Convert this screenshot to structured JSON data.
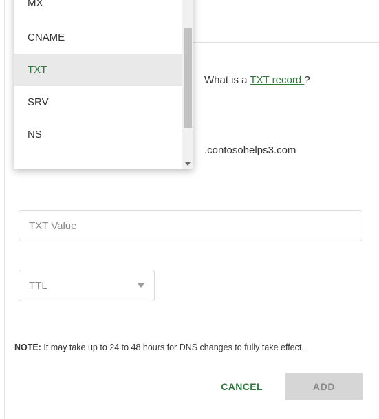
{
  "dropdown": {
    "items": [
      {
        "label": "MX",
        "selected": false
      },
      {
        "label": "CNAME",
        "selected": false
      },
      {
        "label": "TXT",
        "selected": true
      },
      {
        "label": "SRV",
        "selected": false
      },
      {
        "label": "NS",
        "selected": false
      }
    ]
  },
  "help": {
    "prefix": "What is a ",
    "link_text": "TXT record ",
    "suffix": "?"
  },
  "domain_suffix": ".contosohelps3.com",
  "txt_value": {
    "placeholder": "TXT Value",
    "value": ""
  },
  "ttl": {
    "placeholder": "TTL"
  },
  "note": {
    "label": "NOTE:",
    "text": " It may take up to 24 to 48 hours for DNS changes to fully take effect."
  },
  "actions": {
    "cancel": "CANCEL",
    "add": "ADD"
  }
}
